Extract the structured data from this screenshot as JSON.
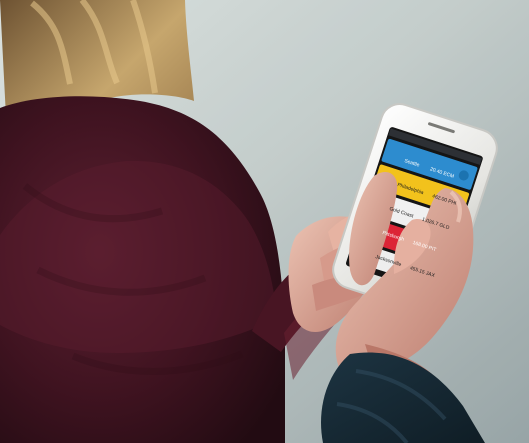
{
  "scene": {
    "description_items": [
      "woman-with-blond-hair",
      "burgundy-sweater",
      "hands-holding-smartphone"
    ]
  },
  "phone": {
    "cards": [
      {
        "name": "Seattle",
        "value": "20.40 ECM",
        "change": "+1.03 (+1.00%)",
        "color": "#2d8ccf"
      },
      {
        "name": "Philadelphia",
        "value": "462.00 PHI",
        "change": "+2.08 (+1.45%)",
        "color": "#f2c21c"
      },
      {
        "name": "Gold Coast",
        "value": "1,026.7 GLD",
        "change": "+16.8 (+1.66%)",
        "color": "#f0f0f0"
      },
      {
        "name": "Pittsburgh",
        "value": "168.00 PIT",
        "change": "+30.0 (+2.00%)",
        "color": "#dc2436"
      },
      {
        "name": "Jacksonville",
        "value": "455.15 JAX",
        "change": "+6.40 (+1.05%)",
        "color": "#eeeeee"
      }
    ]
  },
  "colors": {
    "wall": "#b9c4c3",
    "sweater": "#4a1624",
    "hair": "#b8955d",
    "skin": "#d9a494",
    "phone_body": "#e7e7e5",
    "screen_dark": "#151515"
  }
}
